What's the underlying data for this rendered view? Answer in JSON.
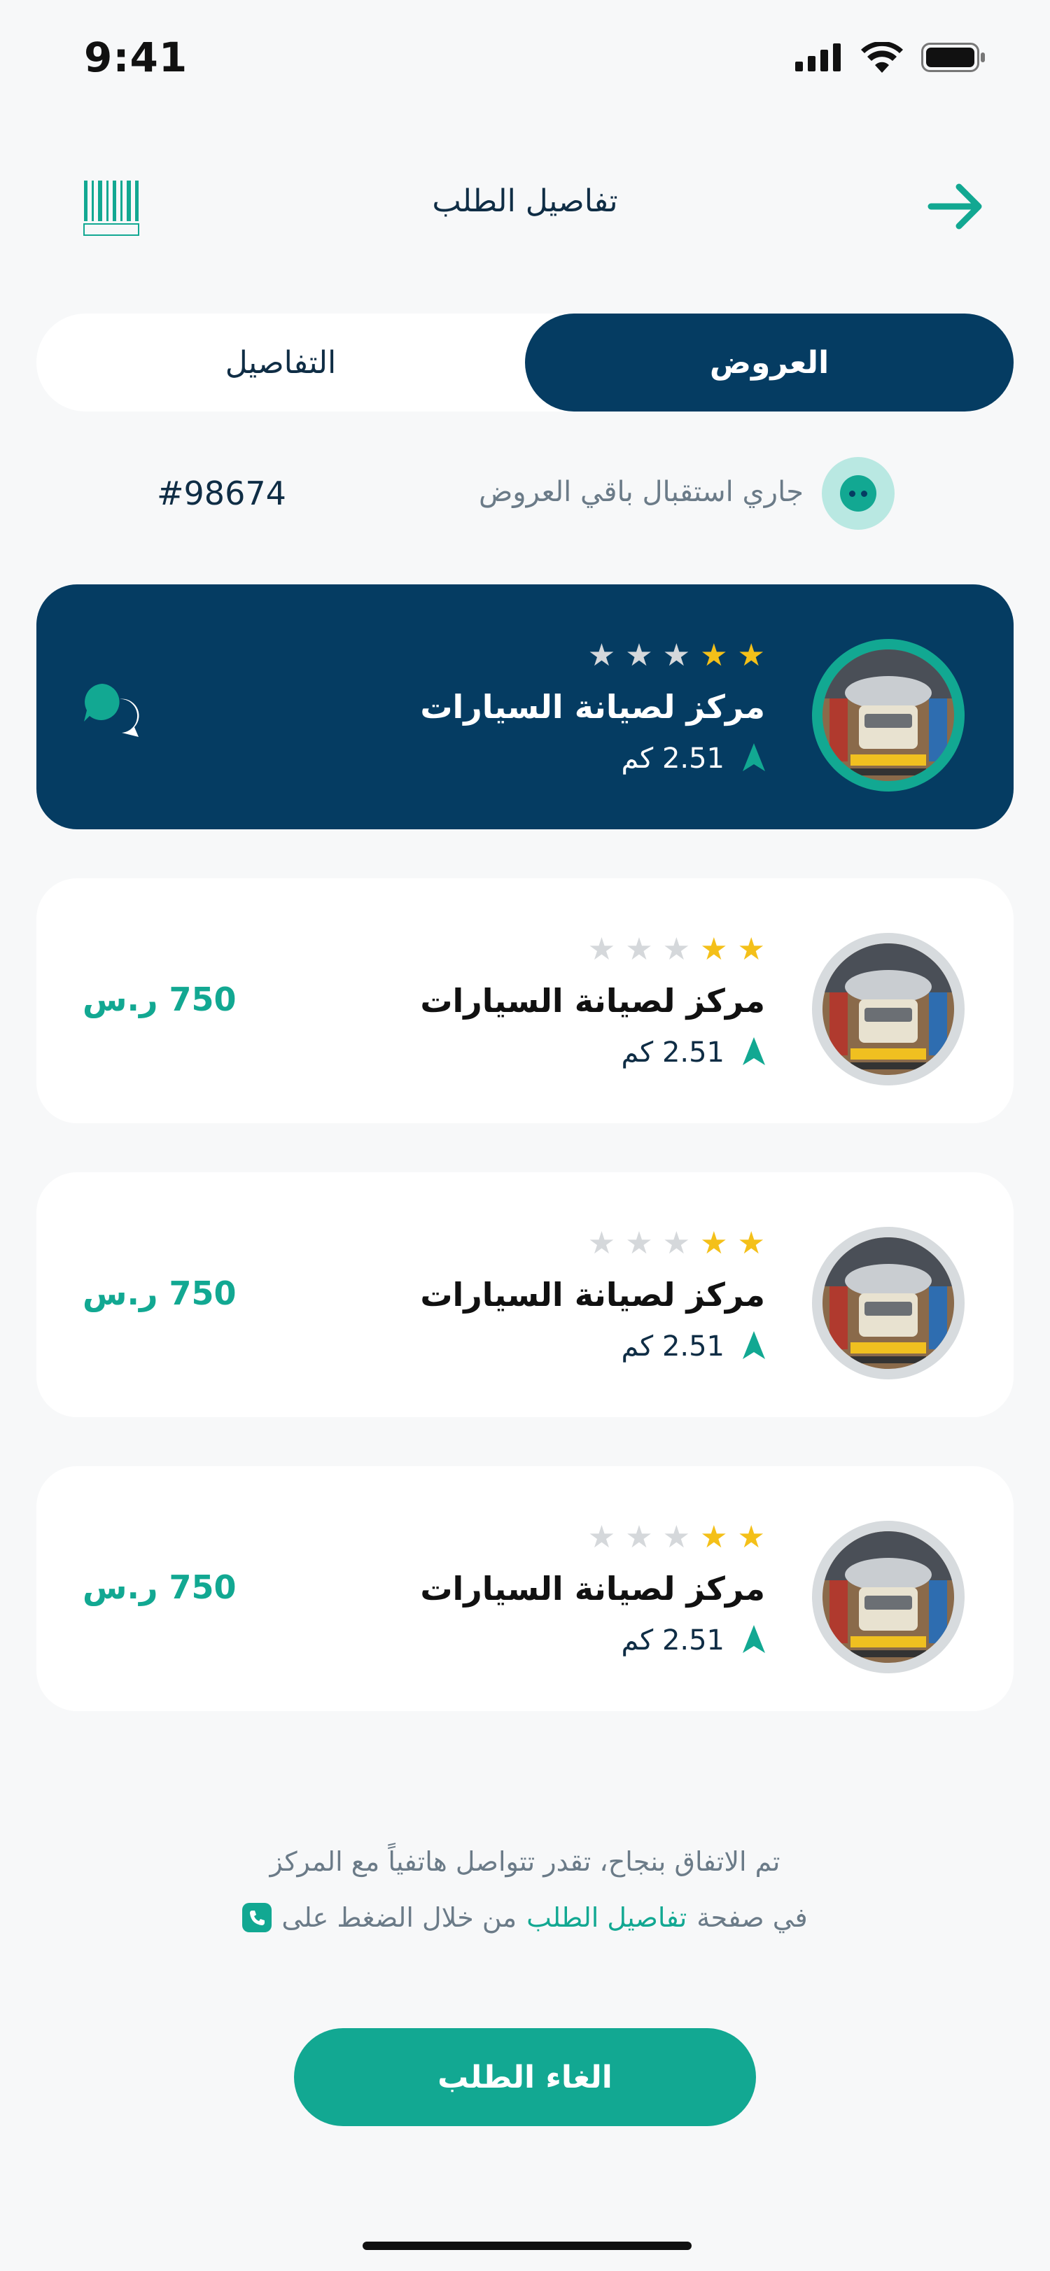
{
  "status_bar": {
    "time": "9:41"
  },
  "header": {
    "title": "تفاصيل الطلب"
  },
  "tabs": [
    {
      "label": "العروض",
      "active": true
    },
    {
      "label": "التفاصيل",
      "active": false
    }
  ],
  "order": {
    "number": "#98674",
    "receiving_text": "جاري استقبال باقي العروض"
  },
  "offers": [
    {
      "name": "مركز لصيانة السيارات",
      "distance": "2.51 كم",
      "rating": 2,
      "price": "",
      "active": true
    },
    {
      "name": "مركز لصيانة السيارات",
      "distance": "2.51 كم",
      "rating": 2,
      "price": "750 ر.س",
      "active": false
    },
    {
      "name": "مركز لصيانة السيارات",
      "distance": "2.51 كم",
      "rating": 2,
      "price": "750 ر.س",
      "active": false
    },
    {
      "name": "مركز لصيانة السيارات",
      "distance": "2.51 كم",
      "rating": 2,
      "price": "750 ر.س",
      "active": false
    }
  ],
  "note": {
    "line1": "تم الاتفاق بنجاح، تقدر تتواصل هاتفياً مع المركز",
    "line2_prefix": "في صفحة",
    "line2_link": "تفاصيل الطلب",
    "line2_suffix": "من خلال الضغط على"
  },
  "actions": {
    "cancel_label": "الغاء الطلب"
  },
  "colors": {
    "primary": "#053c62",
    "accent": "#12a892",
    "star": "#f4c019"
  }
}
